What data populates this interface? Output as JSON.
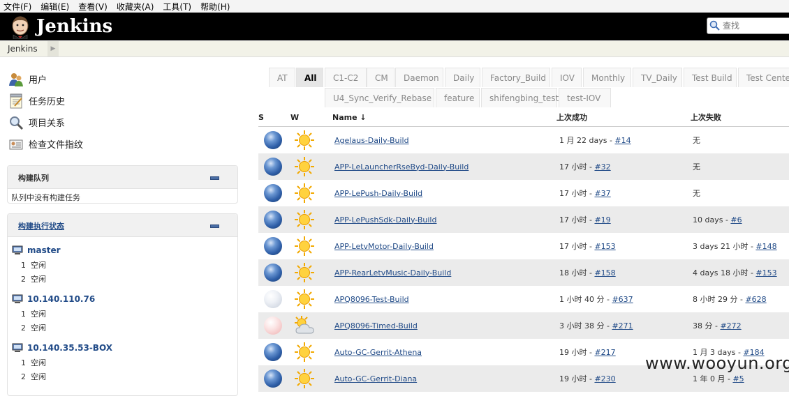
{
  "menu": [
    "文件(F)",
    "编辑(E)",
    "查看(V)",
    "收藏夹(A)",
    "工具(T)",
    "帮助(H)"
  ],
  "header": {
    "title": "Jenkins",
    "search_placeholder": "查找"
  },
  "breadcrumb": [
    "Jenkins"
  ],
  "sidenav": [
    {
      "label": "用户",
      "icon": "users-icon"
    },
    {
      "label": "任务历史",
      "icon": "notepad-icon"
    },
    {
      "label": "项目关系",
      "icon": "magnifier-icon"
    },
    {
      "label": "检查文件指纹",
      "icon": "fingerprint-icon"
    }
  ],
  "build_queue": {
    "title": "构建队列",
    "empty_text": "队列中没有构建任务"
  },
  "executors": {
    "title": "构建执行状态",
    "computers": [
      {
        "name": "master",
        "slots": [
          {
            "num": "1",
            "status": "空闲"
          },
          {
            "num": "2",
            "status": "空闲"
          }
        ]
      },
      {
        "name": "10.140.110.76",
        "slots": [
          {
            "num": "1",
            "status": "空闲"
          },
          {
            "num": "2",
            "status": "空闲"
          }
        ]
      },
      {
        "name": "10.140.35.53-BOX",
        "slots": [
          {
            "num": "1",
            "status": "空闲"
          },
          {
            "num": "2",
            "status": "空闲"
          }
        ]
      }
    ]
  },
  "tabs_row1": [
    "AT",
    "All",
    "C1-C2",
    "CM",
    "Daemon",
    "Daily",
    "Factory_Build",
    "IOV",
    "Monthly",
    "TV_Daily",
    "Test Build",
    "Test Center"
  ],
  "tabs_row2": [
    "U4_Sync_Verify_Rebase",
    "feature",
    "shifengbing_test",
    "test-IOV"
  ],
  "active_tab": "All",
  "table": {
    "headers": {
      "s": "S",
      "w": "W",
      "name": "Name",
      "sort": "↓",
      "last_success": "上次成功",
      "last_failure": "上次失败"
    },
    "rows": [
      {
        "status": "blue",
        "weather": "sunny",
        "name": "Agelaus-Daily-Build",
        "ls_text": "1 月 22 days - ",
        "ls_build": "#14",
        "lf_text": "无",
        "lf_build": ""
      },
      {
        "status": "blue",
        "weather": "sunny",
        "name": "APP-LeLauncherRseByd-Daily-Build",
        "ls_text": "17 小时 - ",
        "ls_build": "#32",
        "lf_text": "无",
        "lf_build": ""
      },
      {
        "status": "blue",
        "weather": "sunny",
        "name": "APP-LePush-Daily-Build",
        "ls_text": "17 小时 - ",
        "ls_build": "#37",
        "lf_text": "无",
        "lf_build": ""
      },
      {
        "status": "blue",
        "weather": "sunny",
        "name": "APP-LePushSdk-Daily-Build",
        "ls_text": "17 小时 - ",
        "ls_build": "#19",
        "lf_text": "10 days - ",
        "lf_build": "#6"
      },
      {
        "status": "blue",
        "weather": "sunny",
        "name": "APP-LetvMotor-Daily-Build",
        "ls_text": "17 小时 - ",
        "ls_build": "#153",
        "lf_text": "3 days 21 小时 - ",
        "lf_build": "#148"
      },
      {
        "status": "blue",
        "weather": "sunny",
        "name": "APP-RearLetvMusic-Daily-Build",
        "ls_text": "18 小时 - ",
        "ls_build": "#158",
        "lf_text": "4 days 18 小时 - ",
        "lf_build": "#153"
      },
      {
        "status": "grey",
        "weather": "sunny",
        "name": "APQ8096-Test-Build",
        "ls_text": "1 小时 40 分 - ",
        "ls_build": "#637",
        "lf_text": "8 小时 29 分 - ",
        "lf_build": "#628"
      },
      {
        "status": "red",
        "weather": "partly-cloudy",
        "name": "APQ8096-Timed-Build",
        "ls_text": "3 小时 38 分 - ",
        "ls_build": "#271",
        "lf_text": "38 分 - ",
        "lf_build": "#272"
      },
      {
        "status": "blue",
        "weather": "sunny",
        "name": "Auto-GC-Gerrit-Athena",
        "ls_text": "19 小时 - ",
        "ls_build": "#217",
        "lf_text": "1 月 3 days - ",
        "lf_build": "#184"
      },
      {
        "status": "blue",
        "weather": "sunny",
        "name": "Auto-GC-Gerrit-Diana",
        "ls_text": "19 小时 - ",
        "ls_build": "#230",
        "lf_text": "1 年 0 月 - ",
        "lf_build": "#5"
      }
    ]
  },
  "watermark": "www.wooyun.org"
}
